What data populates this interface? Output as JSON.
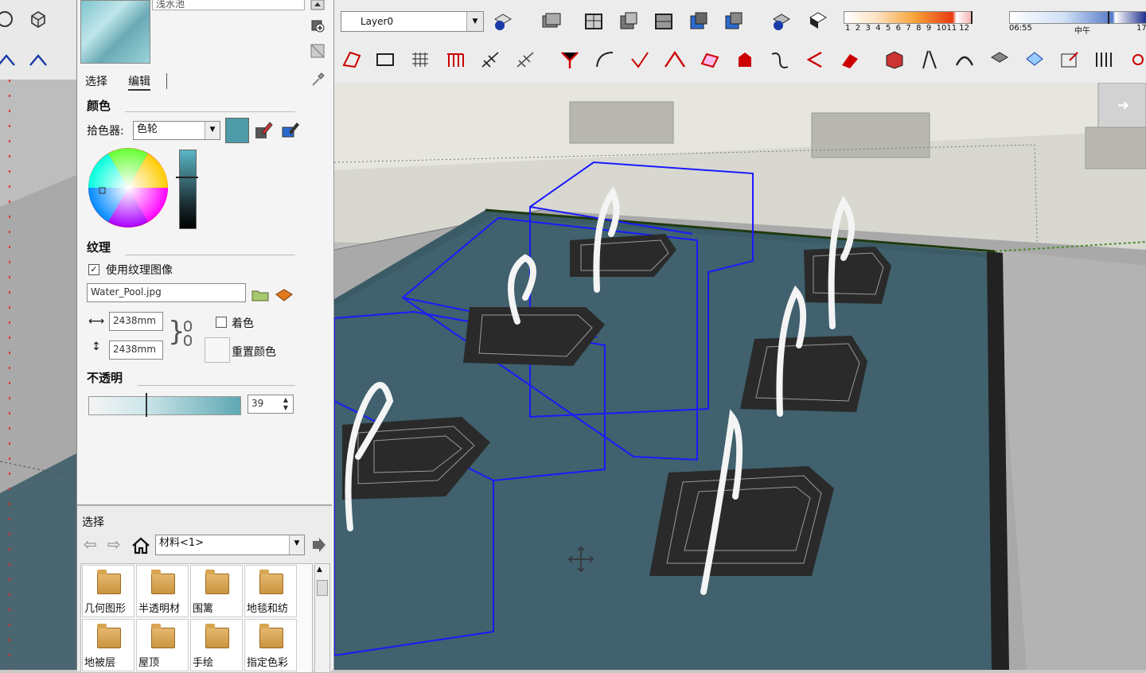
{
  "material_name": "浅水池",
  "tabs": {
    "select": "选择",
    "edit": "编辑"
  },
  "color": {
    "section_title": "颜色",
    "picker_label": "拾色器:",
    "picker_value": "色轮",
    "swatch_color": "#4f9aa8"
  },
  "texture": {
    "section_title": "纹理",
    "use_texture_label": "使用纹理图像",
    "use_texture_checked": true,
    "filename": "Water_Pool.jpg",
    "width": "2438mm",
    "height": "2438mm",
    "colorize_label": "着色",
    "reset_color_label": "重置颜色"
  },
  "opacity": {
    "section_title": "不透明",
    "value": "39"
  },
  "select_section": {
    "title": "选择",
    "library_value": "材料<1>",
    "folders": [
      {
        "label": "几何图形"
      },
      {
        "label": "半透明材"
      },
      {
        "label": "围篱"
      },
      {
        "label": "地毯和纺"
      },
      {
        "label": "地被层"
      },
      {
        "label": "屋顶"
      },
      {
        "label": "手绘"
      },
      {
        "label": "指定色彩"
      }
    ]
  },
  "toolbar": {
    "layer_value": "Layer0",
    "shadow_months": [
      "1",
      "2",
      "3",
      "4",
      "5",
      "6",
      "7",
      "8",
      "9",
      "10",
      "11",
      "12"
    ],
    "time_start": "06:55",
    "time_mid": "中午",
    "time_end": "17"
  },
  "colors": {
    "water": "#3b5b66",
    "selection_blue": "#1a1aff",
    "panel_bg": "#f4f4f4"
  }
}
